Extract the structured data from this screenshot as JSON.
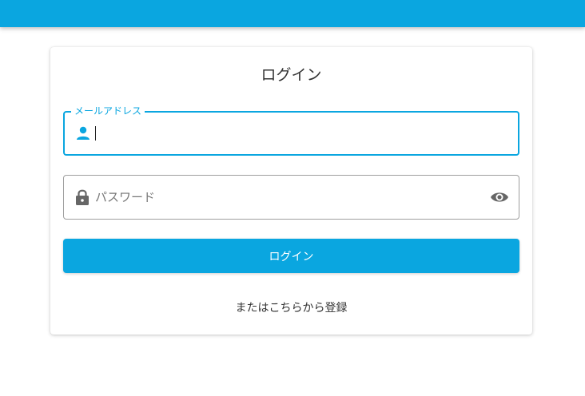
{
  "colors": {
    "primary": "#0aa6e0",
    "text": "#333333",
    "border": "#9e9e9e",
    "icon": "#666666"
  },
  "header": {
    "bar": ""
  },
  "login_card": {
    "title": "ログイン",
    "email": {
      "label": "メールアドレス",
      "value": "",
      "icon": "person-icon"
    },
    "password": {
      "placeholder": "パスワード",
      "value": "",
      "icon": "lock-icon",
      "toggle_icon": "eye-icon"
    },
    "submit_label": "ログイン",
    "register_link": "またはこちらから登録"
  }
}
